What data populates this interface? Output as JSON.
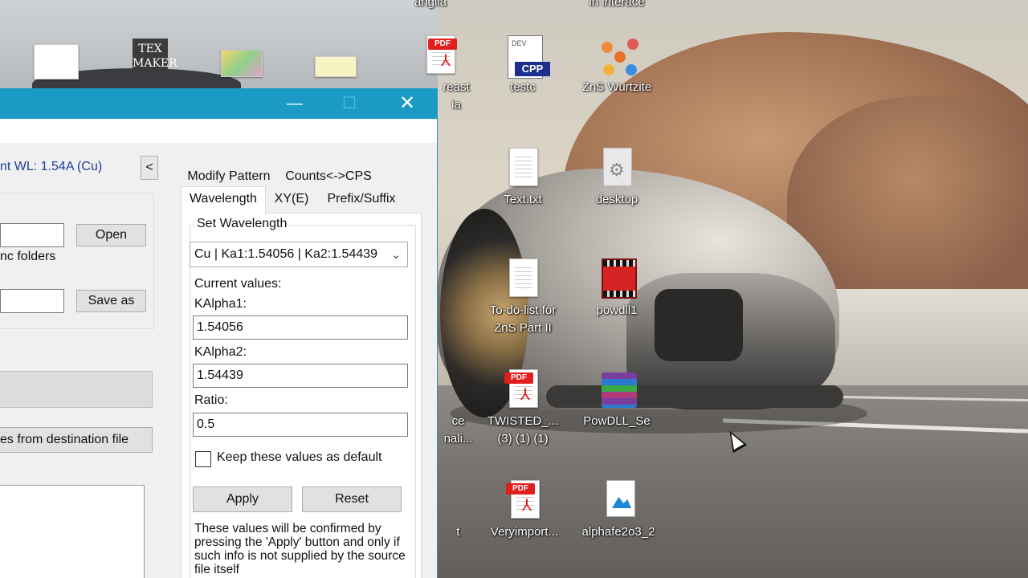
{
  "desktop": {
    "icons": [
      {
        "label": "anglia",
        "icon": "doc-icon"
      },
      {
        "label": "in interace",
        "icon": "doc-icon"
      },
      {
        "label": "reast",
        "sublabel": "ia",
        "icon": "pdf-icon"
      },
      {
        "label": "testc",
        "icon": "cpp-file-icon",
        "badge": "CPP"
      },
      {
        "label": "ZnS Wurtzite",
        "icon": "molecule-icon"
      },
      {
        "label": "Text.txt",
        "icon": "text-file-icon"
      },
      {
        "label": "desktop",
        "icon": "settings-file-icon"
      },
      {
        "label": "To-do-list for",
        "sublabel": "ZnS Part II",
        "icon": "text-file-icon"
      },
      {
        "label": "powdll1",
        "icon": "video-file-icon"
      },
      {
        "label": "TWISTED_...",
        "sublabel": "(3) (1) (1)",
        "icon": "pdf-icon"
      },
      {
        "label": "PowDLL_Se",
        "icon": "winrar-archive-icon"
      },
      {
        "label": "Veryimport...",
        "icon": "pdf-icon"
      },
      {
        "label": "alphafe2o3_2",
        "icon": "image-file-icon"
      },
      {
        "label": "ce",
        "sublabel": "nali...",
        "icon": "doc-icon"
      },
      {
        "label": "t",
        "icon": "doc-icon"
      }
    ],
    "pdf_badge": "PDF",
    "tex_label": "TEX MAKER",
    "colors": {
      "label_text": "#ffffff",
      "pdf_red": "#e21d1d"
    }
  },
  "window": {
    "title_buttons": {
      "minimize": "—",
      "maximize": "☐",
      "close": "✕"
    },
    "accent": "#1a9ac5",
    "current_wl": "nt WL: 1.54A (Cu)",
    "collapse_button": "<",
    "left": {
      "open_button": "Open",
      "sync_folders_label": "nc folders",
      "save_as_button": "Save as",
      "dest_file_button": "es from destination  file"
    },
    "tabs_row1": [
      "Modify Pattern",
      "Counts<->CPS"
    ],
    "tabs_row2": [
      "Wavelength",
      "XY(E)",
      "Prefix/Suffix"
    ],
    "active_tab": "Wavelength",
    "wavelength": {
      "group_title": "Set Wavelength",
      "select_value": "Cu | Ka1:1.54056 | Ka2:1.54439",
      "current_values_label": "Current values:",
      "kalpha1_label": "KAlpha1:",
      "kalpha1_value": "1.54056",
      "kalpha2_label": "KAlpha2:",
      "kalpha2_value": "1.54439",
      "ratio_label": "Ratio:",
      "ratio_value": "0.5",
      "keep_default_label": "Keep these values as default",
      "keep_default_checked": false,
      "apply_button": "Apply",
      "reset_button": "Reset",
      "note": "These values will be confirmed by pressing the 'Apply' button and only if such info is not supplied by the source file itself"
    }
  }
}
